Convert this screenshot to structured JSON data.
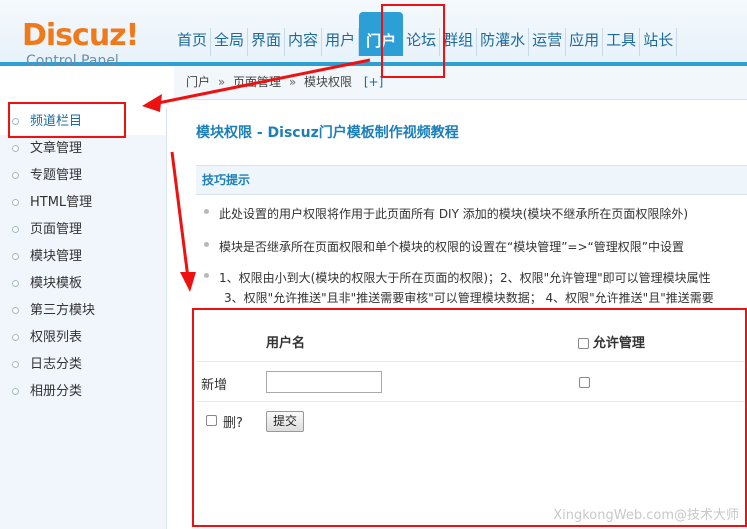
{
  "logo": {
    "name": "Discuz",
    "mark": "!",
    "subtitle": "Control Panel"
  },
  "nav": [
    {
      "label": "首页"
    },
    {
      "label": "全局"
    },
    {
      "label": "界面"
    },
    {
      "label": "内容"
    },
    {
      "label": "用户"
    },
    {
      "label": "门户",
      "active": true
    },
    {
      "label": "论坛"
    },
    {
      "label": "群组"
    },
    {
      "label": "防灌水"
    },
    {
      "label": "运营"
    },
    {
      "label": "应用"
    },
    {
      "label": "工具"
    },
    {
      "label": "站长"
    }
  ],
  "breadcrumb": {
    "items": [
      "门户",
      "页面管理",
      "模块权限"
    ],
    "separator": "»",
    "expand": "[+]"
  },
  "sidebar": [
    {
      "label": "频道栏目",
      "active": true
    },
    {
      "label": "文章管理"
    },
    {
      "label": "专题管理"
    },
    {
      "label": "HTML管理"
    },
    {
      "label": "页面管理"
    },
    {
      "label": "模块管理"
    },
    {
      "label": "模块模板"
    },
    {
      "label": "第三方模块"
    },
    {
      "label": "权限列表"
    },
    {
      "label": "日志分类"
    },
    {
      "label": "相册分类"
    }
  ],
  "page_title": "模块权限 - Discuz门户模板制作视频教程",
  "tips": {
    "header": "技巧提示",
    "items": [
      "此处设置的用户权限将作用于此页面所有 DIY 添加的模块(模块不继承所在页面权限除外)",
      "模块是否继承所在页面权限和单个模块的权限的设置在“模块管理”=>“管理权限”中设置",
      "1、权限由小到大(模块的权限大于所在页面的权限)；2、权限\"允许管理\"即可以管理模块属性",
      "3、权限\"允许推送\"且非\"推送需要审核\"可以管理模块数据；  4、权限\"允许推送\"且\"推送需要"
    ]
  },
  "table": {
    "col_username": "用户名",
    "col_allow_manage": "允许管理",
    "add_label": "新增",
    "username_value": "",
    "delete_label": "删?",
    "submit_label": "提交"
  },
  "watermark": "XingkongWeb.com@技术大师",
  "colors": {
    "accent": "#2b9fd6",
    "annotation": "#e11111",
    "logo": "#ee7a1c"
  }
}
